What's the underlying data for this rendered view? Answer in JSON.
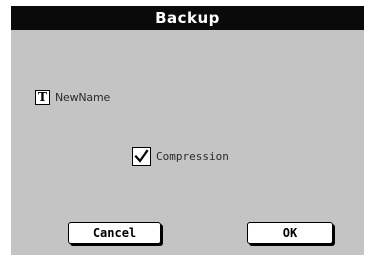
{
  "dialog": {
    "title": "Backup"
  },
  "name_field": {
    "icon": "text-icon",
    "icon_glyph": "T",
    "value": "NewName"
  },
  "compression": {
    "label": "Compression",
    "checked": true
  },
  "buttons": {
    "cancel_label": "Cancel",
    "ok_label": "OK"
  }
}
